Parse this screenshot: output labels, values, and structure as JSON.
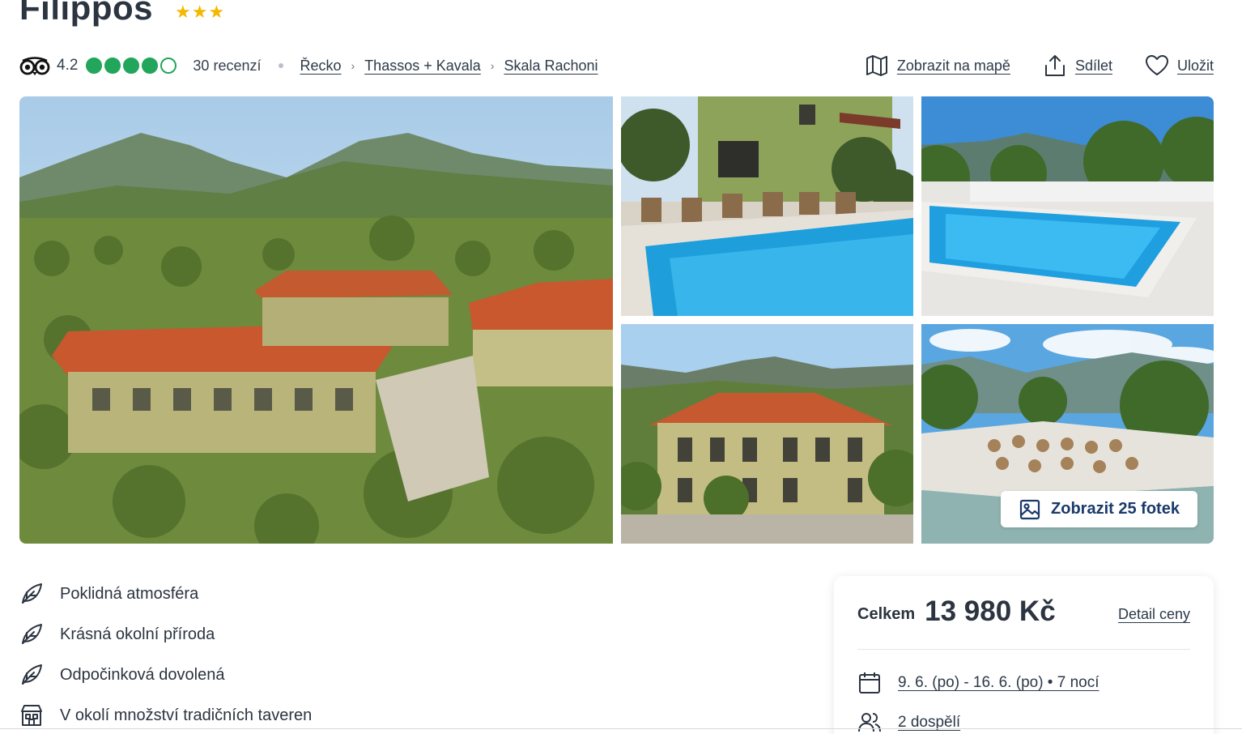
{
  "hotel": {
    "name": "Filippos",
    "stars": "★★★"
  },
  "rating": {
    "score": "4.2",
    "bubbles_filled": 4,
    "bubbles_total": 5,
    "reviews": "30 recenzí"
  },
  "breadcrumbs": [
    "Řecko",
    "Thassos + Kavala",
    "Skala Rachoni"
  ],
  "actions": {
    "map": "Zobrazit na mapě",
    "share": "Sdílet",
    "save": "Uložit"
  },
  "gallery": {
    "show_photos": "Zobrazit 25 fotek"
  },
  "features": [
    {
      "icon": "leaf-icon",
      "label": "Poklidná atmosféra"
    },
    {
      "icon": "leaf-icon",
      "label": "Krásná okolní příroda"
    },
    {
      "icon": "leaf-icon",
      "label": "Odpočinková dovolená"
    },
    {
      "icon": "building-icon",
      "label": "V okolí množství tradičních taveren"
    }
  ],
  "price": {
    "total_label": "Celkem",
    "total_value": "13 980 Kč",
    "detail_link": "Detail ceny",
    "dates": "9. 6. (po) - 16. 6. (po) • 7 nocí",
    "people": "2 dospělí"
  },
  "colors": {
    "tripadvisor_green": "#21a65b",
    "star_gold": "#f5b800",
    "text_dark": "#2b3440",
    "button_text": "#1a3a6b"
  }
}
